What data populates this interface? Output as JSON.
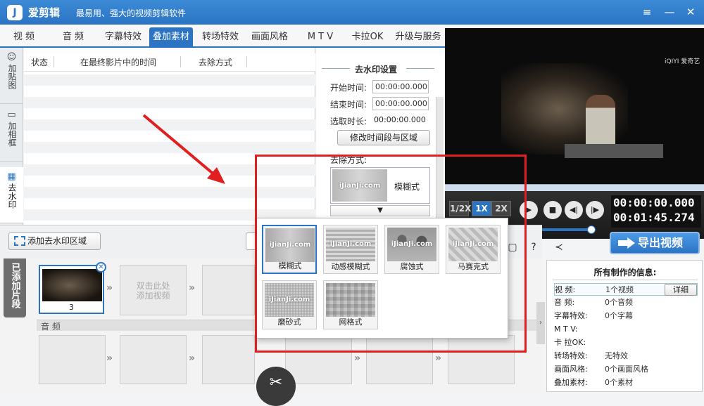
{
  "app": {
    "name": "爱剪辑",
    "tagline": "最易用、强大的视频剪辑软件",
    "logo": "J"
  },
  "window_controls": {
    "menu": "≡",
    "minimize": "—",
    "maximize": "❐",
    "close": "✕"
  },
  "tabs": [
    {
      "label": "视 频"
    },
    {
      "label": "音 频"
    },
    {
      "label": "字幕特效"
    },
    {
      "label": "叠加素材"
    },
    {
      "label": "转场特效"
    },
    {
      "label": "画面风格"
    },
    {
      "label": "M T V"
    },
    {
      "label": "卡拉OK"
    },
    {
      "label": "升级与服务"
    }
  ],
  "side_tabs": [
    {
      "label": "加贴图"
    },
    {
      "label": "加相框"
    },
    {
      "label": "去水印"
    }
  ],
  "list": {
    "headers": [
      "状态",
      "在最终影片中的时间",
      "去除方式"
    ]
  },
  "settings": {
    "title": "去水印设置",
    "start_label": "开始时间:",
    "start_value": "00:00:00.000",
    "end_label": "结束时间:",
    "end_value": "00:00:00.000",
    "duration_label": "选取时长:",
    "duration_value": "00:00:00.000",
    "modify_button": "修改时间段与区域",
    "remove_method_label": "去除方式:",
    "current_style": "模糊式",
    "thumb_watermark": "iJianJi.com",
    "dropdown_arrow": "▼"
  },
  "preview": {
    "watermark": "iQIYI 爱奇艺",
    "speeds": [
      "1/2X",
      "1X",
      "2X"
    ],
    "current_time": "00:00:00.000",
    "total_time": "00:01:45.274"
  },
  "toolbar": {
    "add_watermark_area": "添加去水印区域",
    "export": "导出视频"
  },
  "timeline": {
    "tab_label": "已添加片段",
    "clip1_number": "3",
    "placeholder": "双击此处\n添加视频",
    "audio_label": "音 频"
  },
  "info": {
    "title": "所有制作的信息:",
    "detail_button": "详细",
    "rows": [
      {
        "key": "视 频:",
        "value": "1个视频"
      },
      {
        "key": "音 频:",
        "value": "0个音频"
      },
      {
        "key": "字幕特效:",
        "value": "0个字幕"
      },
      {
        "key": "M T V:",
        "value": ""
      },
      {
        "key": "卡 拉OK:",
        "value": ""
      },
      {
        "key": "转场特效:",
        "value": "无特效"
      },
      {
        "key": "画面风格:",
        "value": "0个画面风格"
      },
      {
        "key": "叠加素材:",
        "value": "0个素材"
      }
    ]
  },
  "dropdown": {
    "thumb_watermark": "iJianJi.com",
    "options": [
      {
        "label": "模糊式",
        "selected": true
      },
      {
        "label": "动感模糊式",
        "selected": false
      },
      {
        "label": "腐蚀式",
        "selected": false
      },
      {
        "label": "马赛克式",
        "selected": false
      },
      {
        "label": "磨砂式",
        "selected": false
      },
      {
        "label": "网格式",
        "selected": false
      }
    ]
  },
  "colors": {
    "accent": "#2b74c4",
    "highlight": "#e02020"
  }
}
